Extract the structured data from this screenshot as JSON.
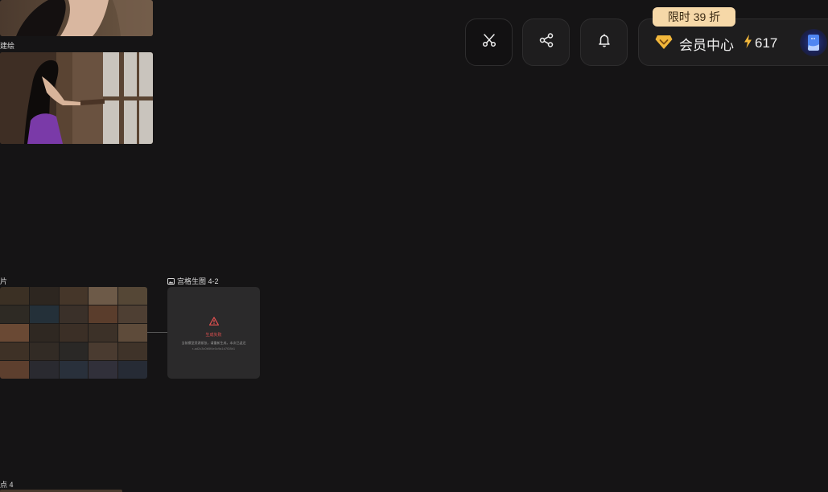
{
  "nodes": {
    "top_left_label": "建绘",
    "grid_label": "片",
    "failed_label": "宫格生图 4-2",
    "bottom_label": "点 4"
  },
  "failed_card": {
    "title": "生成失败",
    "description": "当前模型资源紧张，请重新生成，本次已返还",
    "code": "r-ad2c3c0b5f4e0c9a1d7f28b1"
  },
  "toolbar": {
    "icons": [
      "scissors-icon",
      "share-icon",
      "bell-icon"
    ],
    "member_center": "会员中心",
    "credits": "617",
    "promo": "限时 39 折"
  },
  "colors": {
    "background": "#151415",
    "promo": "#f6d8a8",
    "accent_gold": "#f2b73b",
    "error": "#e05050"
  }
}
